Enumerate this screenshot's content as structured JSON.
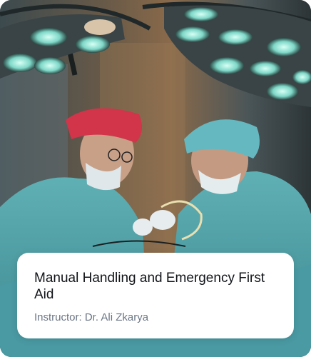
{
  "course": {
    "title": "Manual Handling and Emergency First Aid",
    "instructor": "Instructor: Dr. Ali Zkarya"
  },
  "image": {
    "subject_icon": "surgeons-photo"
  },
  "colors": {
    "card_background": "#ffffff",
    "title_text": "#111418",
    "instructor_text": "#6b7685",
    "scrub_teal": "#56a6ad"
  }
}
